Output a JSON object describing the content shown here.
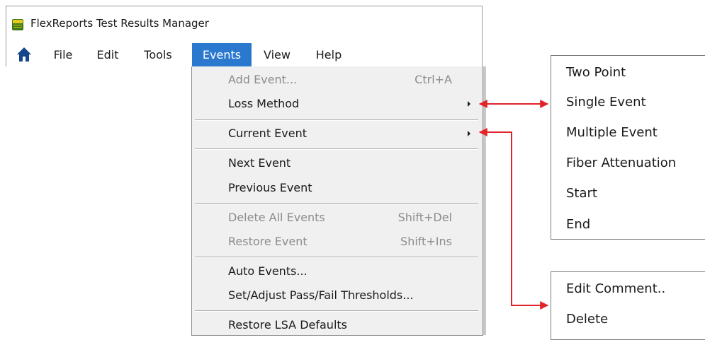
{
  "window": {
    "title": "FlexReports Test Results Manager",
    "icon": "app-logo-icon"
  },
  "menubar": {
    "items": [
      "File",
      "Edit",
      "Tools",
      "Events",
      "View",
      "Help"
    ],
    "active": "Events"
  },
  "events_menu": {
    "items": [
      {
        "label": "Add Event...",
        "shortcut": "Ctrl+A",
        "disabled": true
      },
      {
        "label": "Loss Method",
        "submenu": true
      },
      {
        "label": "Current Event",
        "submenu": true
      },
      {
        "label": "Next Event"
      },
      {
        "label": "Previous Event"
      },
      {
        "label": "Delete All Events",
        "shortcut": "Shift+Del",
        "disabled": true
      },
      {
        "label": "Restore Event",
        "shortcut": "Shift+Ins",
        "disabled": true
      },
      {
        "label": "Auto Events..."
      },
      {
        "label": "Set/Adjust Pass/Fail Thresholds..."
      },
      {
        "label": "Restore LSA Defaults"
      }
    ]
  },
  "loss_method_submenu": {
    "items": [
      "Two Point",
      "Single Event",
      "Multiple Event",
      "Fiber Attenuation",
      "Start",
      "End"
    ]
  },
  "current_event_submenu": {
    "items": [
      "Edit Comment..",
      "Delete"
    ]
  },
  "colors": {
    "accent": "#2b78cf",
    "arrow": "#e0242a",
    "disabled_text": "#8c8c8c",
    "menu_bg": "#f0f0f0",
    "home_icon": "#14468c"
  }
}
